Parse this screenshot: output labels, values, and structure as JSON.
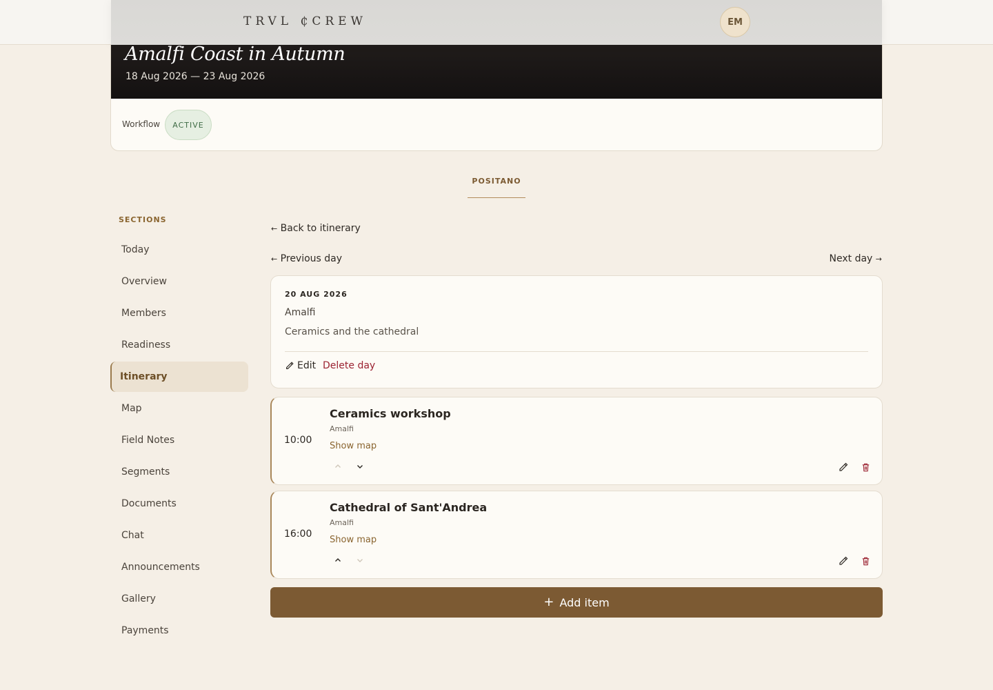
{
  "header": {
    "brand": "TRVL ₵CREW",
    "avatar_initials": "EM"
  },
  "trip": {
    "title": "Amalfi Coast in Autumn",
    "dates": "18 Aug 2026 — 23 Aug 2026",
    "workflow_label": "Workflow",
    "status": "ACTIVE"
  },
  "city_tab": "POSITANO",
  "sidebar": {
    "heading": "SECTIONS",
    "items": [
      {
        "label": "Today"
      },
      {
        "label": "Overview"
      },
      {
        "label": "Members"
      },
      {
        "label": "Readiness"
      },
      {
        "label": "Itinerary",
        "active": true
      },
      {
        "label": "Map"
      },
      {
        "label": "Field Notes"
      },
      {
        "label": "Segments"
      },
      {
        "label": "Documents"
      },
      {
        "label": "Chat"
      },
      {
        "label": "Announcements"
      },
      {
        "label": "Gallery"
      },
      {
        "label": "Payments"
      }
    ]
  },
  "nav": {
    "back": "Back to itinerary",
    "previous": "Previous day",
    "next": "Next day",
    "left_arrow": "←",
    "right_arrow": "→"
  },
  "day": {
    "date": "20 AUG 2026",
    "place": "Amalfi",
    "description": "Ceramics and the cathedral",
    "edit_label": "Edit",
    "delete_label": "Delete day"
  },
  "items": [
    {
      "time": "10:00",
      "title": "Ceramics workshop",
      "location": "Amalfi",
      "map_label": "Show map",
      "can_move_up": false,
      "can_move_down": true
    },
    {
      "time": "16:00",
      "title": "Cathedral of Sant'Andrea",
      "location": "Amalfi",
      "map_label": "Show map",
      "can_move_up": true,
      "can_move_down": false
    }
  ],
  "add_item": {
    "plus": "+",
    "label": "Add item"
  },
  "colors": {
    "page_bg": "#f5efe6",
    "accent": "#7c5a33",
    "danger": "#9b2231",
    "active_status": "#3f6b45"
  }
}
